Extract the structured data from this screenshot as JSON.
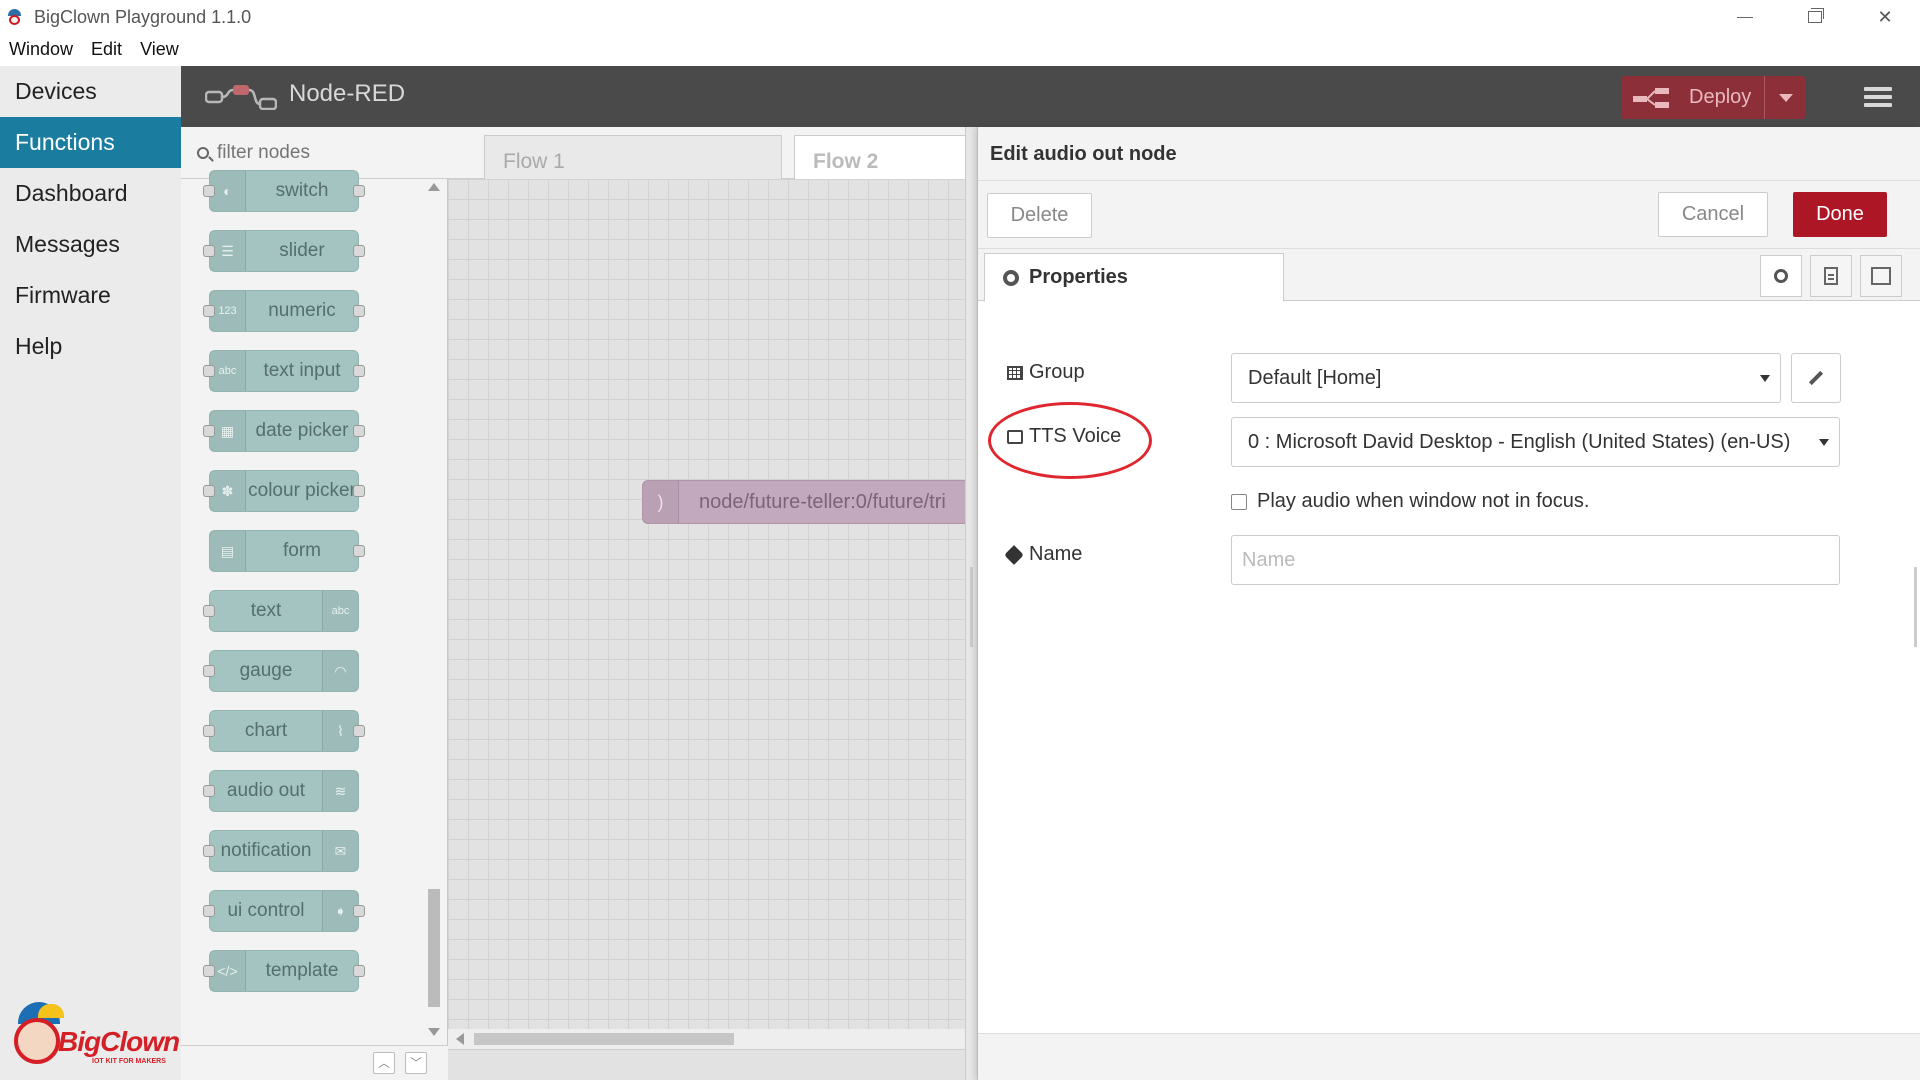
{
  "window": {
    "title": "BigClown Playground 1.1.0",
    "menu": [
      "Window",
      "Edit",
      "View"
    ]
  },
  "sidebar": {
    "items": [
      {
        "label": "Devices"
      },
      {
        "label": "Functions",
        "active": true
      },
      {
        "label": "Dashboard"
      },
      {
        "label": "Messages"
      },
      {
        "label": "Firmware"
      },
      {
        "label": "Help"
      }
    ],
    "brand": {
      "name": "BigClown",
      "tagline": "IOT KIT FOR MAKERS"
    }
  },
  "nodered": {
    "title": "Node-RED",
    "deploy_label": "Deploy"
  },
  "palette": {
    "filter_placeholder": "filter nodes",
    "nodes": [
      {
        "label": "switch",
        "icon": "toggle-icon"
      },
      {
        "label": "slider",
        "icon": "sliders-icon"
      },
      {
        "label": "numeric",
        "icon": "123-icon"
      },
      {
        "label": "text input",
        "icon": "abc-icon"
      },
      {
        "label": "date picker",
        "icon": "calendar-icon"
      },
      {
        "label": "colour picker",
        "icon": "palette-icon"
      },
      {
        "label": "form",
        "icon": "form-icon"
      },
      {
        "label": "text",
        "icon": "abc-icon"
      },
      {
        "label": "gauge",
        "icon": "gauge-icon"
      },
      {
        "label": "chart",
        "icon": "line-chart-icon"
      },
      {
        "label": "audio out",
        "icon": "audio-icon"
      },
      {
        "label": "notification",
        "icon": "envelope-icon"
      },
      {
        "label": "ui control",
        "icon": "arrow-icon"
      },
      {
        "label": "template",
        "icon": "code-icon"
      }
    ]
  },
  "workspace": {
    "tabs": [
      "Flow 1",
      "Flow 2"
    ],
    "flow_node_label": "node/future-teller:0/future/tri"
  },
  "editor": {
    "title": "Edit audio out node",
    "delete_label": "Delete",
    "cancel_label": "Cancel",
    "done_label": "Done",
    "properties_tab": "Properties",
    "group_label": "Group",
    "group_value": "Default [Home]",
    "tts_label": "TTS Voice",
    "tts_value": "0 : Microsoft David Desktop - English (United States) (en-US)",
    "checkbox_label": "Play audio when window not in focus.",
    "name_label": "Name",
    "name_placeholder": "Name"
  },
  "colors": {
    "sidebar_active": "#1a7da0",
    "deploy": "#8c2f38",
    "done": "#ad1625",
    "palette_node": "#a4c4c1",
    "flow_node": "#c3a9bd",
    "highlight_ring": "#e0262e"
  }
}
